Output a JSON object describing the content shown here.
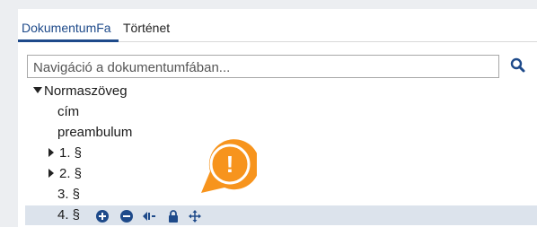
{
  "tabs": [
    {
      "label": "DokumentumFa",
      "active": true
    },
    {
      "label": "Történet",
      "active": false
    }
  ],
  "search": {
    "placeholder": "Navigáció a dokumentumfában...",
    "value": ""
  },
  "tree": {
    "root_label": "Normaszöveg",
    "items": [
      "cím",
      "preambulum",
      "1. §",
      "2. §",
      "3. §",
      "4. §"
    ]
  },
  "actions": [
    "plus-circle-icon",
    "minus-circle-icon",
    "outdent-icon",
    "lock-icon",
    "move-arrows-icon"
  ],
  "callout": {
    "symbol": "!",
    "color": "#f7941d"
  },
  "colors": {
    "accent": "#1e4a8a",
    "selected_row": "#dce3ec"
  }
}
